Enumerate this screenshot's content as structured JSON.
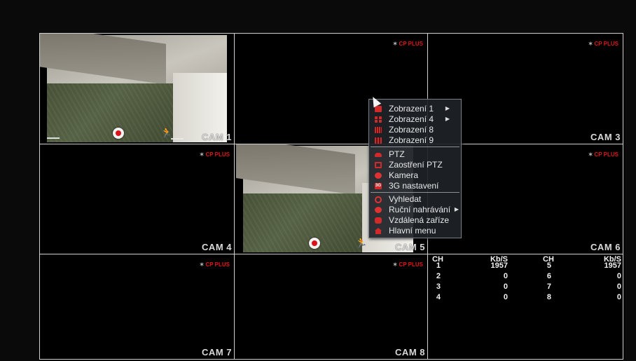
{
  "tiles": [
    {
      "id": "cam1",
      "label": "CAM 1",
      "brand": "",
      "timestamp_left": "",
      "timestamp_right": "",
      "has_picture": true
    },
    {
      "id": "cam2",
      "label": "",
      "brand": "CP PLUS",
      "has_picture": false
    },
    {
      "id": "cam3",
      "label": "CAM 3",
      "brand": "CP PLUS",
      "has_picture": false
    },
    {
      "id": "cam4",
      "label": "CAM 4",
      "brand": "CP PLUS",
      "has_picture": false
    },
    {
      "id": "cam5",
      "label": "CAM 5",
      "brand": "",
      "has_picture": true
    },
    {
      "id": "cam6",
      "label": "CAM 6",
      "brand": "CP PLUS",
      "has_picture": false
    },
    {
      "id": "cam7",
      "label": "CAM 7",
      "brand": "CP PLUS",
      "has_picture": false
    },
    {
      "id": "cam8",
      "label": "CAM 8",
      "brand": "CP PLUS",
      "has_picture": false
    }
  ],
  "colors": {
    "brand": "#e01515",
    "menu_icon": "#d22a2a",
    "label": "#d9d9d9"
  },
  "menu": {
    "groups": [
      [
        {
          "label": "Zobrazení 1",
          "icon": "view-1-icon",
          "submenu": true
        },
        {
          "label": "Zobrazení 4",
          "icon": "view-4-icon",
          "submenu": true
        },
        {
          "label": "Zobrazení 8",
          "icon": "view-8-icon",
          "submenu": false
        },
        {
          "label": "Zobrazení 9",
          "icon": "view-9-icon",
          "submenu": false
        }
      ],
      [
        {
          "label": "PTZ",
          "icon": "ptz-icon",
          "submenu": false
        },
        {
          "label": "Zaostření PTZ",
          "icon": "focus-icon",
          "submenu": false
        },
        {
          "label": "Kamera",
          "icon": "camera-icon",
          "submenu": false
        },
        {
          "label": "3G nastavení",
          "icon": "3g-icon",
          "submenu": false
        }
      ],
      [
        {
          "label": "Vyhledat",
          "icon": "search-icon",
          "submenu": false
        },
        {
          "label": "Ruční nahrávání",
          "icon": "record-icon",
          "submenu": true
        },
        {
          "label": "Vzdálená zaříze",
          "icon": "remote-device-icon",
          "submenu": false
        },
        {
          "label": "Hlavní menu",
          "icon": "home-icon",
          "submenu": false
        }
      ]
    ],
    "submenu_glyph": "▶",
    "badge_3g": "3G"
  },
  "bitrate": {
    "headers": {
      "ch": "CH",
      "kbs": "Kb/S"
    },
    "rows": [
      {
        "ch_a": "1",
        "kbs_a": "1957",
        "ch_b": "5",
        "kbs_b": "1957"
      },
      {
        "ch_a": "2",
        "kbs_a": "0",
        "ch_b": "6",
        "kbs_b": "0"
      },
      {
        "ch_a": "3",
        "kbs_a": "0",
        "ch_b": "7",
        "kbs_b": "0"
      },
      {
        "ch_a": "4",
        "kbs_a": "0",
        "ch_b": "8",
        "kbs_b": "0"
      }
    ]
  }
}
